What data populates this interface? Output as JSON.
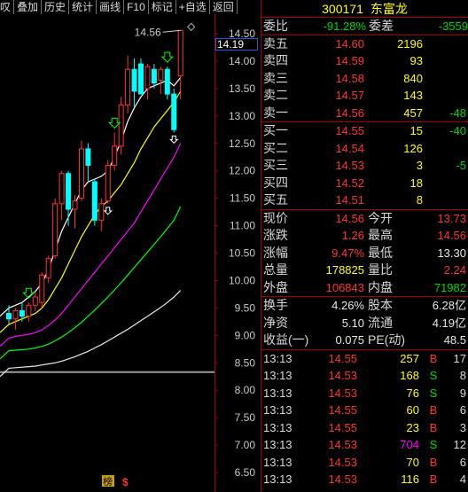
{
  "toolbar": [
    "叹",
    "叠加",
    "历史",
    "统计",
    "画线",
    "F10",
    "标记",
    "+自选",
    "返回"
  ],
  "stock": {
    "code": "300171",
    "name": "东富龙"
  },
  "weibi": {
    "label": "委比",
    "value": "-91.28%",
    "label2": "委差",
    "value2": "-3559"
  },
  "sell": [
    {
      "label": "卖五",
      "price": "14.60",
      "vol": "2196",
      "chg": ""
    },
    {
      "label": "卖四",
      "price": "14.59",
      "vol": "93",
      "chg": ""
    },
    {
      "label": "卖三",
      "price": "14.58",
      "vol": "840",
      "chg": ""
    },
    {
      "label": "卖二",
      "price": "14.57",
      "vol": "143",
      "chg": ""
    },
    {
      "label": "卖一",
      "price": "14.56",
      "vol": "457",
      "chg": "-48"
    }
  ],
  "buy": [
    {
      "label": "买一",
      "price": "14.55",
      "vol": "15",
      "chg": "-40"
    },
    {
      "label": "买二",
      "price": "14.54",
      "vol": "126",
      "chg": ""
    },
    {
      "label": "买三",
      "price": "14.53",
      "vol": "3",
      "chg": "-5"
    },
    {
      "label": "买四",
      "price": "14.52",
      "vol": "18",
      "chg": ""
    },
    {
      "label": "买五",
      "price": "14.51",
      "vol": "8",
      "chg": ""
    }
  ],
  "quote1": [
    {
      "l1": "现价",
      "v1": "14.56",
      "c1": "red",
      "l2": "今开",
      "v2": "13.73",
      "c2": "red"
    },
    {
      "l1": "涨跌",
      "v1": "1.26",
      "c1": "red",
      "l2": "最高",
      "v2": "14.56",
      "c2": "red"
    },
    {
      "l1": "涨幅",
      "v1": "9.47%",
      "c1": "red",
      "l2": "最低",
      "v2": "13.30",
      "c2": "white"
    },
    {
      "l1": "总量",
      "v1": "178825",
      "c1": "yellow",
      "l2": "量比",
      "v2": "2.24",
      "c2": "red"
    },
    {
      "l1": "外盘",
      "v1": "106843",
      "c1": "red",
      "l2": "内盘",
      "v2": "71982",
      "c2": "green"
    }
  ],
  "quote2": [
    {
      "l1": "换手",
      "v1": "4.26%",
      "l2": "股本",
      "v2": "6.28亿"
    },
    {
      "l1": "净资",
      "v1": "5.10",
      "l2": "流通",
      "v2": "4.19亿"
    },
    {
      "l1": "收益(一)",
      "v1": "0.075",
      "l2": "PE(动)",
      "v2": "48.5"
    }
  ],
  "ticks": [
    {
      "time": "13:13",
      "price": "14.55",
      "vol": "257",
      "dir": "B",
      "n": "17",
      "vc": "yellow"
    },
    {
      "time": "13:13",
      "price": "14.53",
      "vol": "168",
      "dir": "S",
      "n": "8",
      "vc": "yellow"
    },
    {
      "time": "13:13",
      "price": "14.53",
      "vol": "76",
      "dir": "S",
      "n": "9",
      "vc": "yellow"
    },
    {
      "time": "13:13",
      "price": "14.55",
      "vol": "60",
      "dir": "B",
      "n": "6",
      "vc": "yellow"
    },
    {
      "time": "13:13",
      "price": "14.55",
      "vol": "23",
      "dir": "B",
      "n": "3",
      "vc": "yellow"
    },
    {
      "time": "13:13",
      "price": "14.53",
      "vol": "704",
      "dir": "S",
      "n": "12",
      "vc": "magenta"
    },
    {
      "time": "13:13",
      "price": "14.53",
      "vol": "70",
      "dir": "B",
      "n": "6",
      "vc": "yellow"
    },
    {
      "time": "13:13",
      "price": "14.53",
      "vol": "116",
      "dir": "B",
      "n": "4",
      "vc": "yellow"
    },
    {
      "time": "13:13",
      "price": "14.53",
      "vol": "2",
      "dir": "B",
      "n": "1",
      "vc": "yellow"
    }
  ],
  "chart": {
    "current_price_tag": "14.19",
    "high_annotation": "14.56",
    "y_ticks": [
      "14.50",
      "14.00",
      "13.50",
      "13.00",
      "12.50",
      "12.00",
      "11.50",
      "11.00",
      "10.50",
      "10.00",
      "9.50",
      "9.00",
      "8.50",
      "8.00",
      "7.50",
      "7.00",
      "6.50"
    ],
    "bottom_labels": [
      "榜",
      "$"
    ]
  },
  "chart_data": {
    "type": "candlestick",
    "ylim": [
      6.3,
      14.8
    ],
    "candles": [
      {
        "o": 9.4,
        "h": 9.55,
        "l": 9.2,
        "c": 9.3
      },
      {
        "o": 9.3,
        "h": 9.5,
        "l": 9.1,
        "c": 9.45
      },
      {
        "o": 9.45,
        "h": 9.6,
        "l": 9.25,
        "c": 9.35
      },
      {
        "o": 9.35,
        "h": 9.6,
        "l": 9.25,
        "c": 9.55
      },
      {
        "o": 9.55,
        "h": 9.8,
        "l": 9.45,
        "c": 9.7
      },
      {
        "o": 9.6,
        "h": 10.15,
        "l": 9.5,
        "c": 10.1
      },
      {
        "o": 10.05,
        "h": 10.45,
        "l": 9.95,
        "c": 10.4
      },
      {
        "o": 10.45,
        "h": 11.5,
        "l": 10.4,
        "c": 11.4
      },
      {
        "o": 11.4,
        "h": 12.0,
        "l": 11.1,
        "c": 11.95
      },
      {
        "o": 11.95,
        "h": 12.0,
        "l": 11.0,
        "c": 11.3
      },
      {
        "o": 11.3,
        "h": 11.55,
        "l": 10.95,
        "c": 11.45
      },
      {
        "o": 11.5,
        "h": 12.55,
        "l": 11.45,
        "c": 12.4
      },
      {
        "o": 12.4,
        "h": 12.5,
        "l": 11.8,
        "c": 12.1
      },
      {
        "o": 11.8,
        "h": 11.85,
        "l": 11.0,
        "c": 11.1
      },
      {
        "o": 11.1,
        "h": 11.5,
        "l": 10.9,
        "c": 11.4
      },
      {
        "o": 11.45,
        "h": 12.2,
        "l": 11.4,
        "c": 12.1
      },
      {
        "o": 12.1,
        "h": 12.7,
        "l": 12.0,
        "c": 12.45
      },
      {
        "o": 12.45,
        "h": 13.35,
        "l": 12.3,
        "c": 13.2
      },
      {
        "o": 13.2,
        "h": 14.1,
        "l": 13.05,
        "c": 13.85
      },
      {
        "o": 13.85,
        "h": 14.05,
        "l": 13.15,
        "c": 13.45
      },
      {
        "o": 13.95,
        "h": 14.05,
        "l": 13.4,
        "c": 13.4
      },
      {
        "o": 13.5,
        "h": 13.95,
        "l": 13.3,
        "c": 13.9
      },
      {
        "o": 13.85,
        "h": 13.95,
        "l": 13.5,
        "c": 13.6
      },
      {
        "o": 13.65,
        "h": 13.9,
        "l": 13.4,
        "c": 13.85
      },
      {
        "o": 13.85,
        "h": 13.9,
        "l": 13.3,
        "c": 13.4
      },
      {
        "o": 13.4,
        "h": 13.5,
        "l": 12.7,
        "c": 12.75
      },
      {
        "o": 13.73,
        "h": 14.56,
        "l": 13.3,
        "c": 14.56
      }
    ],
    "ma": [
      {
        "name": "MA5",
        "color": "#ffffff",
        "values": [
          9.5,
          9.55,
          9.6,
          9.7,
          9.8,
          9.95,
          10.2,
          10.55,
          10.9,
          11.15,
          11.4,
          11.65,
          11.8,
          11.85,
          11.9,
          12.0,
          12.25,
          12.55,
          12.9,
          13.15,
          13.35,
          13.5,
          13.55,
          13.6,
          13.65,
          13.55,
          13.7
        ]
      },
      {
        "name": "MA10",
        "color": "#ffff00",
        "values": [
          9.2,
          9.25,
          9.3,
          9.35,
          9.4,
          9.5,
          9.65,
          9.85,
          10.05,
          10.3,
          10.55,
          10.8,
          11.0,
          11.2,
          11.35,
          11.45,
          11.6,
          11.75,
          11.95,
          12.15,
          12.4,
          12.6,
          12.8,
          12.95,
          13.1,
          13.25,
          13.45
        ]
      },
      {
        "name": "MA20",
        "color": "#ff00ff",
        "values": [
          8.95,
          8.98,
          9.0,
          9.02,
          9.05,
          9.1,
          9.18,
          9.28,
          9.4,
          9.55,
          9.7,
          9.85,
          10.0,
          10.15,
          10.3,
          10.45,
          10.6,
          10.75,
          10.9,
          11.05,
          11.25,
          11.45,
          11.65,
          11.85,
          12.05,
          12.25,
          12.5
        ]
      },
      {
        "name": "MA30",
        "color": "#00ff00",
        "values": [
          8.72,
          8.73,
          8.74,
          8.75,
          8.77,
          8.8,
          8.84,
          8.9,
          8.97,
          9.05,
          9.14,
          9.24,
          9.35,
          9.46,
          9.58,
          9.7,
          9.83,
          9.96,
          10.1,
          10.24,
          10.38,
          10.52,
          10.66,
          10.8,
          10.95,
          11.1,
          11.35
        ]
      },
      {
        "name": "MA60",
        "color": "#e8e8e8",
        "values": [
          8.4,
          8.41,
          8.42,
          8.43,
          8.44,
          8.46,
          8.48,
          8.5,
          8.53,
          8.57,
          8.61,
          8.66,
          8.71,
          8.77,
          8.83,
          8.9,
          8.97,
          9.04,
          9.11,
          9.19,
          9.27,
          9.35,
          9.43,
          9.51,
          9.6,
          9.7,
          9.82
        ]
      }
    ],
    "buy_arrows": [
      3,
      16,
      24
    ],
    "sell_arrows": [
      15,
      25
    ]
  }
}
